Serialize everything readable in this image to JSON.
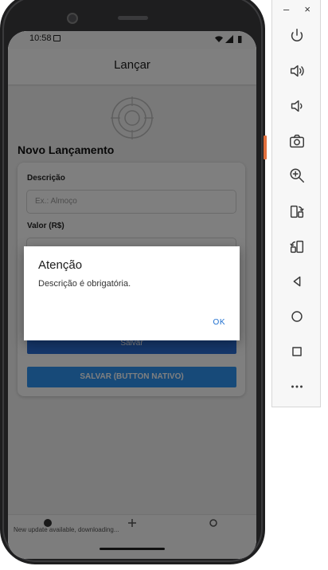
{
  "window": {
    "minimize": "–",
    "close": "×"
  },
  "emulator_toolbar": {
    "buttons": [
      {
        "name": "power-icon"
      },
      {
        "name": "volume-up-icon"
      },
      {
        "name": "volume-down-icon"
      },
      {
        "name": "camera-icon"
      },
      {
        "name": "zoom-icon"
      },
      {
        "name": "rotate-left-icon"
      },
      {
        "name": "rotate-right-icon"
      },
      {
        "name": "back-icon"
      },
      {
        "name": "home-icon"
      },
      {
        "name": "overview-icon"
      },
      {
        "name": "more-icon"
      }
    ]
  },
  "status_bar": {
    "time": "10:58"
  },
  "header": {
    "title": "Lançar"
  },
  "form": {
    "section_title": "Novo Lançamento",
    "description_label": "Descrição",
    "description_placeholder": "Ex.: Almoço",
    "value_label": "Valor (R$)",
    "save_label": "Salvar",
    "save_native_label": "SALVAR (BUTTON NATIVO)"
  },
  "toast": "New update available, downloading...",
  "dialog": {
    "title": "Atenção",
    "message": "Descrição é obrigatória.",
    "ok_label": "OK"
  },
  "colors": {
    "primary": "#2f95f3",
    "dialog_button": "#1e6fd0",
    "side_key": "#e1703e"
  }
}
